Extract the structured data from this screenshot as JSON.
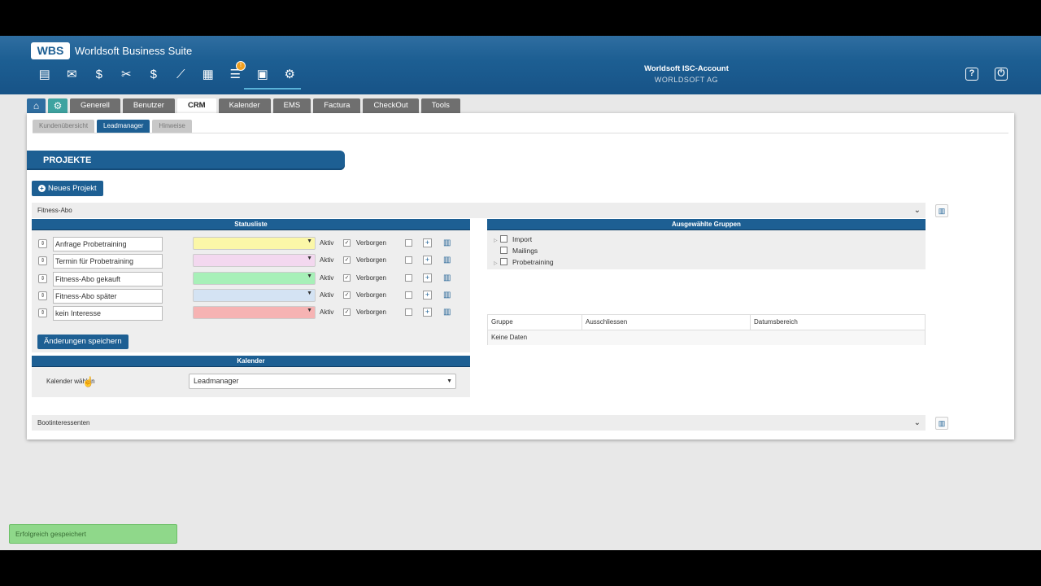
{
  "header": {
    "logo": "WBS",
    "title": "Worldsoft Business Suite",
    "account_title": "Worldsoft ISC-Account",
    "account_sub": "WORLDSOFT AG",
    "notification_count": "!",
    "toolbar_icons": [
      "contacts-icon",
      "mail-icon",
      "sales-icon",
      "tools-icon",
      "finance-icon",
      "stats-icon",
      "calendar-icon",
      "notes-icon",
      "print-icon",
      "settings-icon"
    ],
    "help_icon": "?",
    "power_icon": "⏻"
  },
  "tabs": [
    "Generell",
    "Benutzer",
    "CRM",
    "Kalender",
    "EMS",
    "Factura",
    "CheckOut",
    "Tools"
  ],
  "subtabs": [
    "Kundenübersicht",
    "Leadmanager",
    "Hinweise"
  ],
  "section_title": "PROJEKTE",
  "new_project_label": "Neues Projekt",
  "accordion1": "Fitness-Abo",
  "accordion2": "Bootinteressenten",
  "statusliste": {
    "title": "Statusliste",
    "aktiv_label": "Aktiv",
    "verborgen_label": "Verborgen",
    "rows": [
      {
        "name": "Anfrage Probetraining",
        "color": "#fbf7a8"
      },
      {
        "name": "Termin für Probetraining",
        "color": "#f3d8ef"
      },
      {
        "name": "Fitness-Abo gekauft",
        "color": "#a7f0b8"
      },
      {
        "name": "Fitness-Abo später",
        "color": "#d4e3f3"
      },
      {
        "name": "kein Interesse",
        "color": "#f6b3b3"
      }
    ],
    "save_label": "Änderungen speichern"
  },
  "kalender": {
    "title": "Kalender",
    "label": "Kalender wählen",
    "value": "Leadmanager"
  },
  "gruppen": {
    "title": "Ausgewählte Gruppen",
    "items": [
      "Import",
      "Mailings",
      "Probetraining"
    ],
    "columns": [
      "Gruppe",
      "Ausschliessen",
      "Datumsbereich"
    ],
    "empty": "Keine Daten"
  },
  "toast": "Erfolgreich gespeichert"
}
